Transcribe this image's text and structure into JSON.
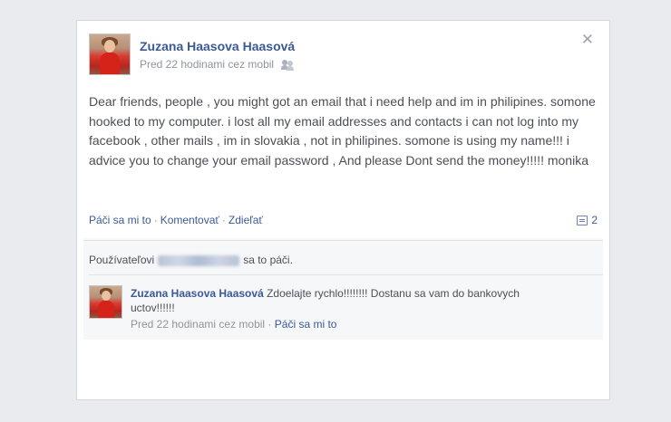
{
  "post": {
    "author": "Zuzana Haasova Haasová",
    "meta": "Pred 22 hodinami cez mobil",
    "audience_icon": "friends-icon",
    "close_icon": "close-icon",
    "close_symbol": "✕",
    "text": "Dear friends, people , you might got an email that i need help and im in philipines. somone hooked to my computer. i lost all my email addresses and contacts i can not log into my facebook , other mails , im in slovakia , not in philipines. somone is using my name!!! i advice you to change your email password , And please Dont send the money!!!!! monika"
  },
  "actions": {
    "like": "Páči sa mi to",
    "comment": "Komentovať",
    "share": "Zdieľať",
    "separator": "·",
    "comment_count": "2"
  },
  "likes": {
    "prefix": "Používateľovi",
    "suffix": "sa to páči."
  },
  "comment": {
    "author": "Zuzana Haasova Haasová",
    "text": "Zdoelajte rychlo!!!!!!!! Dostanu sa vam do bankovych uctov!!!!!!",
    "meta": "Pred 22 hodinami cez mobil",
    "separator": "·",
    "like": "Páči sa mi to"
  },
  "colors": {
    "link": "#3b5998",
    "meta": "#90949c",
    "background": "#e9ebee"
  }
}
